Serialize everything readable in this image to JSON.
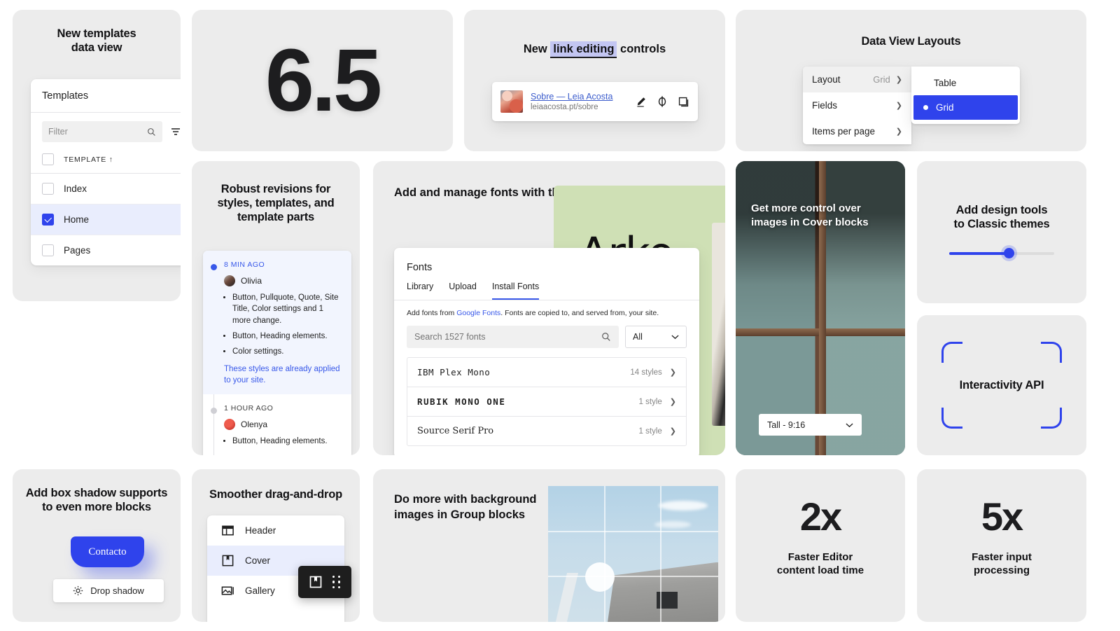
{
  "cards": {
    "templates": {
      "title": "New templates\ndata view",
      "panel_title": "Templates",
      "filter_placeholder": "Filter",
      "column_header": "TEMPLATE ↑",
      "rows": [
        {
          "label": "Index",
          "checked": false
        },
        {
          "label": "Home",
          "checked": true
        },
        {
          "label": "Pages",
          "checked": false
        }
      ]
    },
    "version": {
      "number": "6.5"
    },
    "link_editing": {
      "title_before": "New ",
      "title_highlight": "link editing",
      "title_after": " controls",
      "link_title": "Sobre — Leia Acosta",
      "link_url": "leiaacosta.pt/sobre",
      "actions": [
        "edit-pencil-icon",
        "unlink-icon",
        "copy-icon"
      ]
    },
    "data_view_layouts": {
      "title": "Data View Layouts",
      "menu": [
        {
          "label": "Layout",
          "value": "Grid",
          "active": true
        },
        {
          "label": "Fields",
          "value": "",
          "active": false
        },
        {
          "label": "Items per page",
          "value": "",
          "active": false
        }
      ],
      "submenu": [
        {
          "label": "Table",
          "selected": false
        },
        {
          "label": "Grid",
          "selected": true
        }
      ]
    },
    "revisions": {
      "title": "Robust revisions for styles, templates, and template parts",
      "entries": [
        {
          "time": "8 MIN AGO",
          "user": "Olivia",
          "changes": [
            "Button, Pullquote, Quote, Site Title, Color settings and 1 more change.",
            "Button, Heading elements.",
            "Color settings."
          ],
          "note": "These styles are already applied to your site.",
          "highlighted": true
        },
        {
          "time": "1 HOUR AGO",
          "user": "Olenya",
          "changes": [
            "Button, Heading elements."
          ],
          "note": "",
          "highlighted": false
        }
      ]
    },
    "fonts": {
      "title": "Add and manage fonts with the new Font Library",
      "preview_word": "Arko",
      "panel_title": "Fonts",
      "tabs": [
        {
          "label": "Library",
          "active": false
        },
        {
          "label": "Upload",
          "active": false
        },
        {
          "label": "Install Fonts",
          "active": true
        }
      ],
      "note_before": "Add fonts from ",
      "note_link": "Google Fonts",
      "note_after": ". Fonts are copied to, and served from, your site.",
      "search_placeholder": "Search 1527 fonts",
      "filter_value": "All",
      "list": [
        {
          "name": "IBM Plex Mono",
          "styles": "14 styles"
        },
        {
          "name": "RUBIK MONO ONE",
          "styles": "1 style"
        },
        {
          "name": "Source Serif Pro",
          "styles": "1 style"
        }
      ]
    },
    "cover": {
      "title": "Get more control over images in Cover blocks",
      "aspect_value": "Tall - 9:16"
    },
    "design_tools": {
      "title": "Add design tools\nto Classic themes",
      "slider_percent": 58
    },
    "interactivity": {
      "title": "Interactivity API"
    },
    "box_shadow": {
      "title": "Add box shadow supports\nto even more blocks",
      "button_label": "Contacto",
      "control_label": "Drop shadow"
    },
    "drag_drop": {
      "title": "Smoother drag-and-drop",
      "rows": [
        {
          "label": "Header",
          "icon": "header-block-icon",
          "selected": false
        },
        {
          "label": "Cover",
          "icon": "cover-block-icon",
          "selected": true
        },
        {
          "label": "Gallery",
          "icon": "gallery-block-icon",
          "selected": false
        }
      ],
      "toolbar_icons": [
        "cover-block-icon",
        "drag-grip-icon"
      ]
    },
    "group_blocks": {
      "title": "Do more with background\nimages in Group blocks"
    },
    "stats": [
      {
        "number": "2x",
        "label": "Faster Editor\ncontent load time"
      },
      {
        "number": "5x",
        "label": "Faster input\nprocessing"
      }
    ]
  },
  "colors": {
    "card_bg": "#ececec",
    "accent_blue": "#2f43ec",
    "link_blue": "#3858e9",
    "selection_blue": "#e9edfd",
    "highlight_lavender": "#c3c6f2",
    "arko_green": "#cfe0b5",
    "dark_toolbar": "#1e1e1e"
  }
}
